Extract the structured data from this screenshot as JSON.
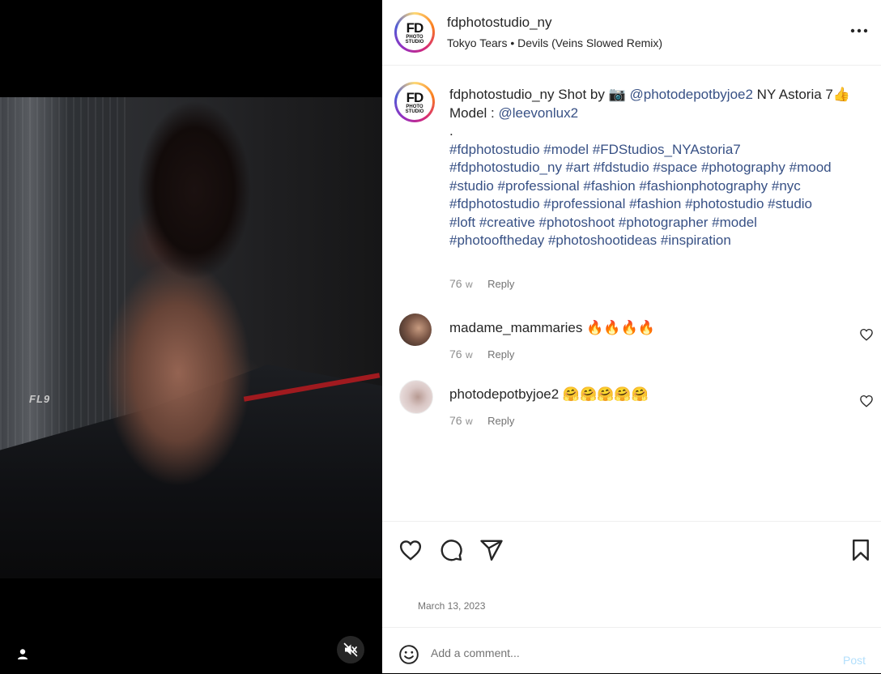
{
  "post": {
    "username": "fdphotostudio_ny",
    "logo_main": "FD",
    "logo_sub": "PHOTO STUDIO",
    "audio": "Tokyo Tears • Devils (Veins Slowed Remix)",
    "media_badge": "FL9"
  },
  "caption": {
    "username": "fdphotostudio_ny",
    "text_1": "Shot by 📷",
    "mention_1": "@photodepotbyjoe2",
    "text_2": " NY Astoria 7👍",
    "model_label": "Model : ",
    "mention_2": "@leevonlux2",
    "dot": ".",
    "hashtag_lines": [
      "#fdphotostudio #model #FDStudios_NYAstoria7",
      "#fdphotostudio_ny #art #fdstudio #space #photography #mood",
      "#studio #professional #fashion #fashionphotography #nyc",
      "#fdphotostudio #professional #fashion #photostudio #studio",
      "#loft #creative #photoshoot #photographer #model",
      "#photooftheday #photoshootideas  #inspiration"
    ],
    "age": "76",
    "age_unit": "w",
    "reply": "Reply"
  },
  "comments": [
    {
      "username": "madame_mammaries",
      "text": "🔥🔥🔥🔥",
      "age": "76",
      "age_unit": "w",
      "reply": "Reply"
    },
    {
      "username": "photodepotbyjoe2",
      "text": "🤗🤗🤗🤗🤗",
      "age": "76",
      "age_unit": "w",
      "reply": "Reply"
    }
  ],
  "date": "March 13, 2023",
  "comment_box": {
    "placeholder": "Add a comment...",
    "post_label": "Post"
  },
  "icons": {
    "more": "more-options-icon",
    "like": "heart-icon",
    "comment": "comment-icon",
    "share": "share-icon",
    "save": "bookmark-icon",
    "emoji": "emoji-icon",
    "mute": "muted-speaker-icon",
    "user_tag": "user-tag-icon"
  },
  "colors": {
    "link": "#385185",
    "post_disabled": "#b2dffc",
    "muted_text": "#737373"
  }
}
